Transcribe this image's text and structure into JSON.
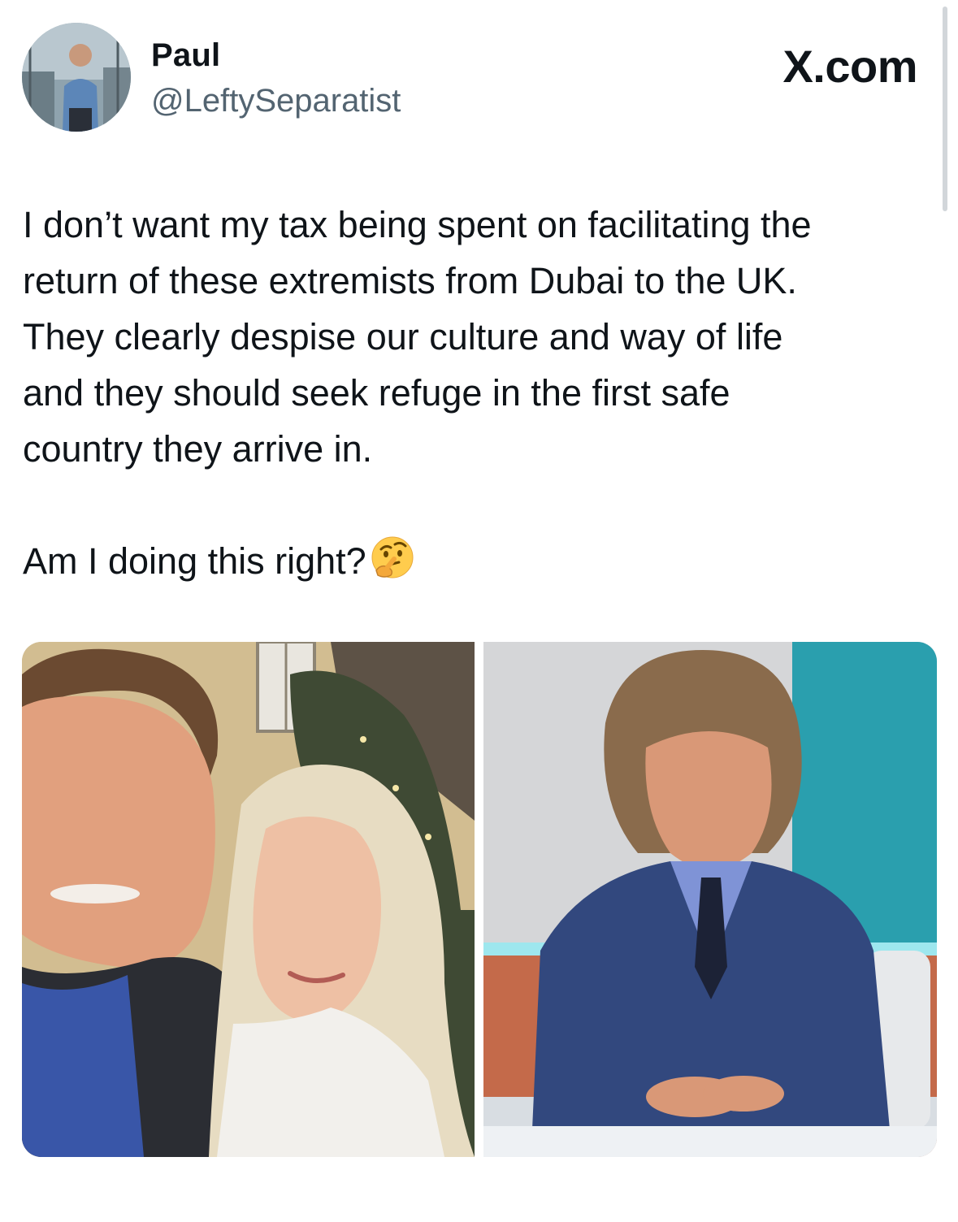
{
  "author": {
    "display_name": "Paul",
    "handle": "@LeftySeparatist",
    "avatar_icon": "profile-photo"
  },
  "brand": {
    "label": "X.com"
  },
  "tweet": {
    "paragraph1_lines": [
      "I don’t want my tax being spent on facilitating the",
      "return of these extremists from Dubai to the UK.",
      "They clearly despise our culture and way of life",
      "and they should seek refuge in the first safe",
      "country they arrive in."
    ],
    "paragraph2": "Am I doing this right?",
    "emoji": "thinking-face-icon"
  },
  "media": [
    {
      "icon": "photo-couple-selfie"
    },
    {
      "icon": "photo-man-tv-studio"
    }
  ],
  "colors": {
    "text": "#0f1419",
    "secondary_text": "#536471",
    "background": "#ffffff"
  }
}
